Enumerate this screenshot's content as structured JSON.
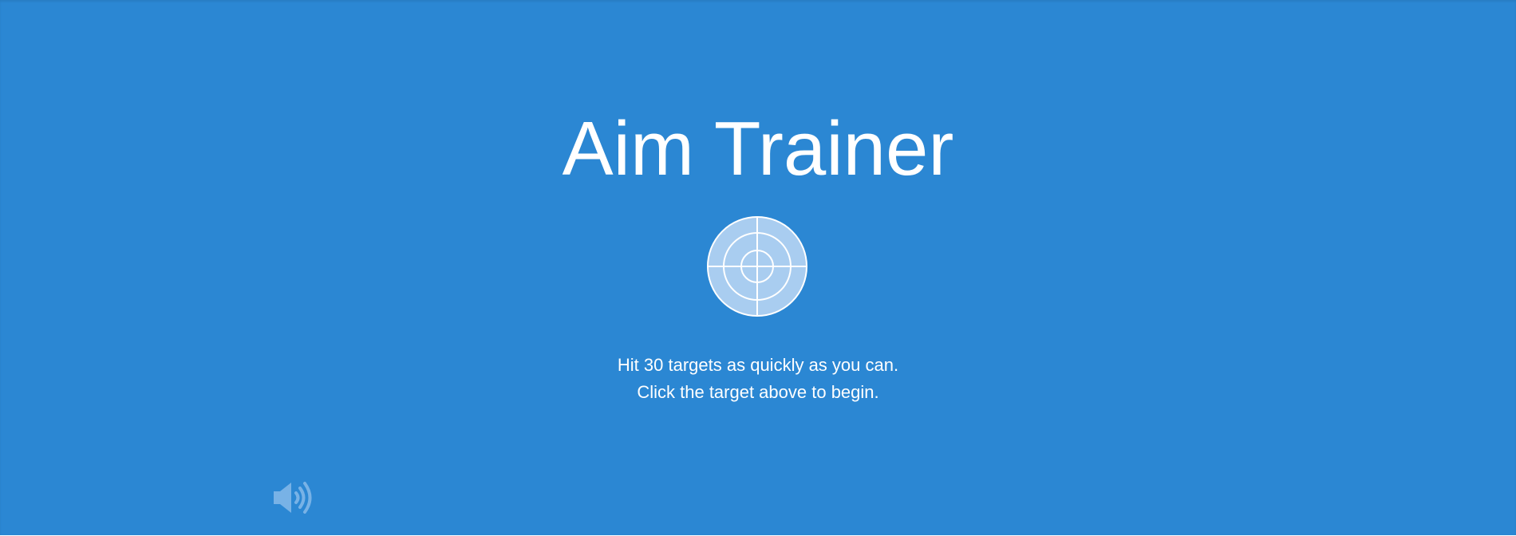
{
  "game": {
    "title": "Aim Trainer",
    "instruction_line_1": "Hit 30 targets as quickly as you can.",
    "instruction_line_2": "Click the target above to begin.",
    "start_target_icon": "target-icon",
    "sound_icon": "speaker-volume-icon"
  },
  "colors": {
    "background": "#2b87d3",
    "text": "#ffffff",
    "target_fill": "#a9cdf0",
    "sound_icon": "#78b2e6"
  }
}
